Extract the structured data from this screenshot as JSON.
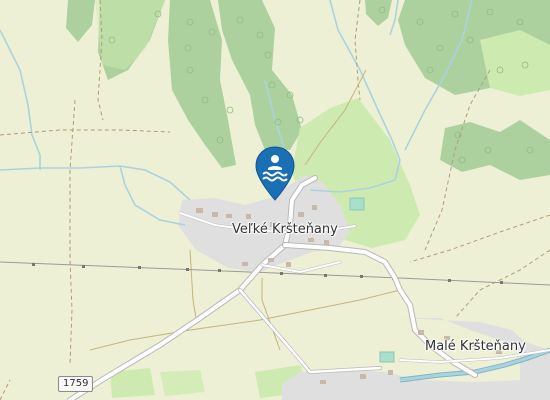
{
  "map": {
    "places": [
      {
        "name": "Veľké Kršteňany"
      },
      {
        "name": "Malé Kršteňany"
      }
    ],
    "road_refs": [
      "1759"
    ],
    "marker": {
      "icon": "swimming-icon",
      "color": "#1b6fb5"
    },
    "colors": {
      "land": "#eef0d5",
      "forest": "#add19e",
      "meadow": "#cdebb0",
      "residential": "#e0dfdf",
      "water": "#aad3df",
      "road": "#ffffff"
    }
  }
}
